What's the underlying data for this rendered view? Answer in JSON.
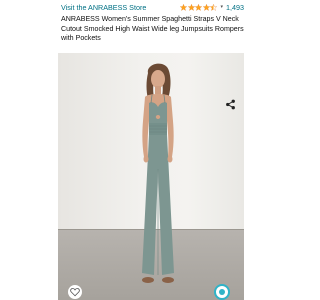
{
  "header": {
    "store_link": "Visit the ANRABESS Store",
    "rating_value": 4.5,
    "rating_max": 5,
    "rating_count": "1,493",
    "title": "ANRABESS Women's Summer Spaghetti Straps V Neck Cutout Smocked High Waist Wide leg Jumpsuits Rompers with Pockets"
  },
  "colors": {
    "link": "#007185",
    "star": "#FFA41C",
    "jumpsuit": "#7d9691",
    "accent": "#30b3c7"
  },
  "icons": {
    "share": "share-icon",
    "heart": "heart-icon",
    "view": "view-in-room-icon",
    "caret": "chevron-down-icon"
  }
}
